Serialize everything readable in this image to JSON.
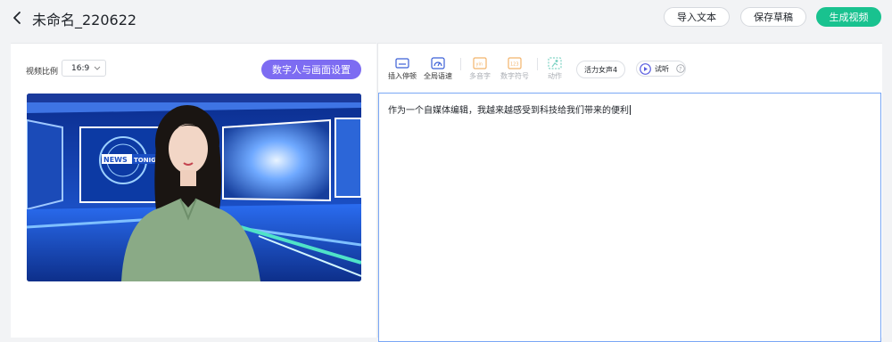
{
  "header": {
    "title": "未命名_220622",
    "import_label": "导入文本",
    "save_label": "保存草稿",
    "generate_label": "生成视频"
  },
  "left": {
    "ratio_label": "视频比例",
    "ratio_value": "16:9",
    "settings_label": "数字人与画面设置",
    "preview": {
      "badge_news": "NEWS",
      "badge_tonight": "TONIGHT"
    }
  },
  "toolbar": {
    "insert_pause": "插入停顿",
    "global_speed": "全局语速",
    "polyphone": "多音字",
    "number_symbol": "数字符号",
    "action": "动作",
    "voice": "活力女声4",
    "listen": "试听"
  },
  "editor": {
    "text": "作为一个自媒体编辑，我越来越感受到科技给我们带来的便利"
  },
  "colors": {
    "accent_green": "#19c28f",
    "accent_purple": "#7d6cf2",
    "editor_border": "#7aa7f5"
  }
}
